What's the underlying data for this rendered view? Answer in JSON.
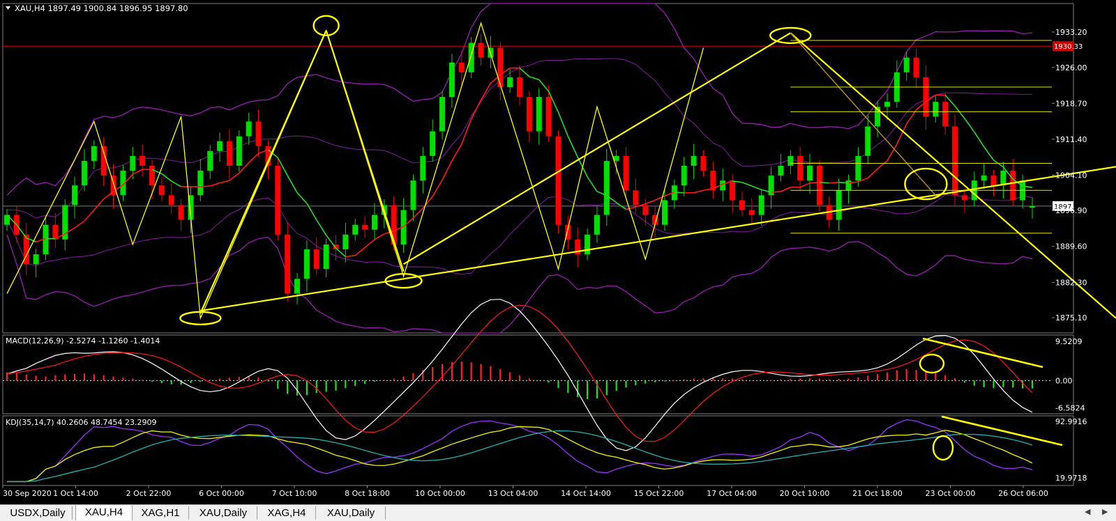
{
  "tabs": [
    {
      "label": "USDX,Daily",
      "active": false
    },
    {
      "label": "XAU,H4",
      "active": true
    },
    {
      "label": "XAG,H1",
      "active": false
    },
    {
      "label": "XAU,Daily",
      "active": false
    },
    {
      "label": "XAG,H4",
      "active": false
    },
    {
      "label": "XAU,Daily",
      "active": false
    }
  ],
  "scroll": {
    "left": "◀",
    "right": "▶"
  },
  "chart_data": [
    {
      "type": "candlestick",
      "title": "XAU,H4  1897.49 1900.84 1896.95 1897.80",
      "ylim": [
        1872,
        1939
      ],
      "y_ticks": [
        "1933.20",
        "1926.00",
        "1918.70",
        "1911.40",
        "1904.10",
        "1896.90",
        "1889.60",
        "1882.30",
        "1875.10"
      ],
      "price_lines": [
        {
          "label": "1930.33",
          "value": 1930.33,
          "color": "#d10000"
        },
        {
          "label": "1897.80",
          "value": 1897.8,
          "color": "#708090"
        }
      ],
      "x_ticks": [
        "30 Sep 2020",
        "1 Oct 14:00",
        "2 Oct 22:00",
        "6 Oct 00:00",
        "7 Oct 10:00",
        "8 Oct 18:00",
        "10 Oct 00:00",
        "13 Oct 04:00",
        "14 Oct 14:00",
        "15 Oct 22:00",
        "17 Oct 04:00",
        "20 Oct 10:00",
        "21 Oct 18:00",
        "23 Oct 00:00",
        "26 Oct 06:00"
      ],
      "candle_closes": [
        1896,
        1892,
        1886,
        1888,
        1894,
        1891,
        1898,
        1902,
        1907,
        1910,
        1904,
        1900,
        1905,
        1908,
        1906,
        1902,
        1900,
        1898,
        1895,
        1900,
        1905,
        1909,
        1911,
        1906,
        1912,
        1915,
        1910,
        1906,
        1892,
        1880,
        1883,
        1889,
        1885,
        1890,
        1889,
        1892,
        1894,
        1893,
        1896,
        1898,
        1890,
        1897,
        1903,
        1908,
        1913,
        1920,
        1927,
        1925,
        1931,
        1928,
        1930,
        1922,
        1924,
        1920,
        1913,
        1920,
        1912,
        1894,
        1891,
        1888,
        1892,
        1896,
        1907,
        1908,
        1901,
        1898,
        1896,
        1894,
        1899,
        1902,
        1906,
        1908,
        1905,
        1901,
        1903,
        1899,
        1897,
        1896,
        1900,
        1904,
        1906,
        1908,
        1903,
        1906,
        1898,
        1895,
        1901,
        1903,
        1908,
        1914,
        1918,
        1919,
        1925,
        1928,
        1924,
        1916,
        1919,
        1914,
        1900,
        1899,
        1903,
        1904,
        1902,
        1905,
        1899,
        1903,
        1897.8
      ],
      "candle_opens": [
        1894,
        1896,
        1892,
        1886,
        1888,
        1894,
        1891,
        1898,
        1902,
        1907,
        1910,
        1904,
        1900,
        1905,
        1908,
        1906,
        1902,
        1900,
        1898,
        1895,
        1900,
        1905,
        1909,
        1911,
        1906,
        1912,
        1915,
        1910,
        1906,
        1892,
        1880,
        1883,
        1889,
        1885,
        1890,
        1889,
        1892,
        1894,
        1893,
        1896,
        1898,
        1890,
        1897,
        1903,
        1908,
        1913,
        1920,
        1927,
        1925,
        1931,
        1928,
        1930,
        1922,
        1924,
        1920,
        1913,
        1920,
        1912,
        1894,
        1891,
        1888,
        1892,
        1896,
        1907,
        1908,
        1901,
        1898,
        1896,
        1894,
        1899,
        1902,
        1906,
        1908,
        1905,
        1901,
        1903,
        1899,
        1897,
        1896,
        1900,
        1904,
        1906,
        1908,
        1903,
        1906,
        1898,
        1895,
        1901,
        1903,
        1908,
        1914,
        1918,
        1919,
        1925,
        1928,
        1924,
        1916,
        1919,
        1914,
        1900,
        1899,
        1903,
        1904,
        1902,
        1905,
        1899,
        1897.49
      ]
    },
    {
      "type": "macd",
      "title": "MACD(12,26,9) -2.5274 -1.1260 -1.4014",
      "ylim": [
        -8.0,
        11.0
      ],
      "y_ticks": [
        "9.5209",
        "0.00",
        "-6.5824"
      ],
      "histogram": [
        2,
        1.8,
        1.5,
        1.2,
        1,
        1.3,
        1.5,
        1.6,
        1.7,
        1.5,
        1.3,
        1,
        0.8,
        0.5,
        0.2,
        -0.3,
        -0.6,
        -0.9,
        -1,
        -0.6,
        -0.3,
        0.2,
        0.5,
        0.7,
        0.9,
        1,
        0.8,
        -0.2,
        -2,
        -3.2,
        -3.6,
        -3.5,
        -3,
        -2.7,
        -2.4,
        -1.8,
        -1.3,
        -0.8,
        -0.3,
        0.2,
        0.5,
        1,
        1.8,
        2.6,
        3.3,
        4,
        4.5,
        4.6,
        4.4,
        4,
        3.5,
        2.8,
        2,
        1.3,
        0.6,
        0.1,
        -0.5,
        -1.8,
        -3,
        -4,
        -4.5,
        -4.3,
        -3.5,
        -2.5,
        -1.7,
        -1.1,
        -0.7,
        -0.4,
        -0.2,
        0.1,
        0.3,
        0.5,
        0.6,
        0.7,
        0.6,
        0.5,
        0.3,
        0.1,
        0,
        0.1,
        0.3,
        0.4,
        0.5,
        0.6,
        0.5,
        0.3,
        0.4,
        0.5,
        0.8,
        1.2,
        1.6,
        2,
        2.5,
        2.8,
        2.6,
        2.2,
        1.8,
        1.3,
        0.6,
        -0.5,
        -1.2,
        -1.6,
        -1.8,
        -1.6,
        -1.7,
        -1.9,
        -1.9
      ]
    },
    {
      "type": "kdj",
      "title": "KDJ(35,14,7) 40.2606 48.7454 23.2909",
      "ylim": [
        10,
        100
      ],
      "y_ticks": [
        "92.9916",
        "19.9718"
      ]
    }
  ]
}
